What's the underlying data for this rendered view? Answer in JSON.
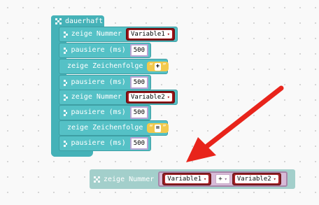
{
  "loop_block": {
    "label": "dauerhaft"
  },
  "statements": [
    {
      "label": "zeige Nummer",
      "type": "variable",
      "value": "Variable1"
    },
    {
      "label": "pausiere (ms)",
      "type": "number",
      "value": "500"
    },
    {
      "label": "zeige Zeichenfolge",
      "type": "string",
      "value": "+"
    },
    {
      "label": "pausiere (ms)",
      "type": "number",
      "value": "500"
    },
    {
      "label": "zeige Nummer",
      "type": "variable",
      "value": "Variable2"
    },
    {
      "label": "pausiere (ms)",
      "type": "number",
      "value": "500"
    },
    {
      "label": "zeige Zeichenfolge",
      "type": "string",
      "value": "="
    },
    {
      "label": "pausiere (ms)",
      "type": "number",
      "value": "500"
    }
  ],
  "loose_block": {
    "label": "zeige Nummer",
    "left_var": "Variable1",
    "operator": "+",
    "right_var": "Variable2"
  },
  "quote_open": "“",
  "quote_close": "”",
  "caret": "▾",
  "colors": {
    "loop": "#45b2b8",
    "statement": "#55c1c6",
    "variable": "#a7171b",
    "number_border": "#b9a3d4",
    "string": "#f2c94c",
    "arrow": "#e8241b"
  }
}
